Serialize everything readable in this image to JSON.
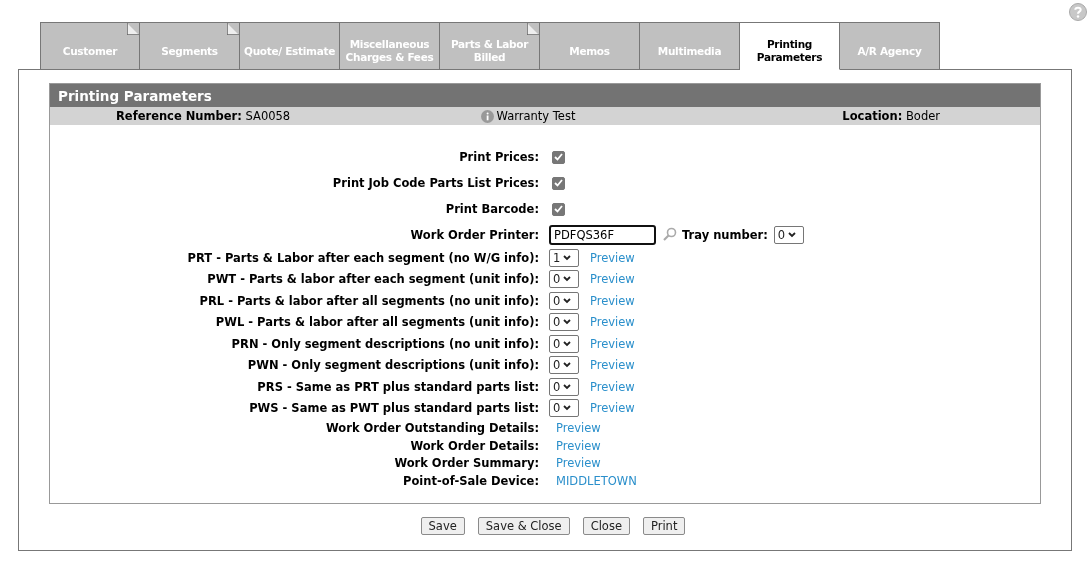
{
  "tabs": [
    {
      "label": "Customer",
      "selected": false,
      "flagged": true
    },
    {
      "label": "Segments",
      "selected": false,
      "flagged": true
    },
    {
      "label": "Quote/ Estimate",
      "selected": false,
      "flagged": false
    },
    {
      "label": "Miscellaneous Charges & Fees",
      "selected": false,
      "flagged": false
    },
    {
      "label": "Parts & Labor Billed",
      "selected": false,
      "flagged": true
    },
    {
      "label": "Memos",
      "selected": false,
      "flagged": false
    },
    {
      "label": "Multimedia",
      "selected": false,
      "flagged": false
    },
    {
      "label": "Printing Parameters",
      "selected": true,
      "flagged": false
    },
    {
      "label": "A/R Agency",
      "selected": false,
      "flagged": false
    }
  ],
  "panel": {
    "title": "Printing Parameters",
    "reference_label": "Reference Number:",
    "reference_value": "SA0058",
    "description": "Warranty Test",
    "location_label": "Location:",
    "location_value": "Boder"
  },
  "rows": [
    {
      "kind": "checkbox",
      "label": "Print Prices:",
      "checked": true
    },
    {
      "kind": "checkbox",
      "label": "Print Job Code Parts List Prices:",
      "checked": true
    },
    {
      "kind": "checkbox",
      "label": "Print Barcode:",
      "checked": true
    },
    {
      "kind": "printer",
      "label": "Work Order Printer:",
      "value": "PDFQS36F",
      "tray_label": "Tray number:",
      "tray_value": "0"
    },
    {
      "kind": "select",
      "label": "PRT - Parts & Labor after each segment (no W/G info):",
      "value": "1",
      "link": "Preview"
    },
    {
      "kind": "select",
      "label": "PWT - Parts & labor after each segment (unit info):",
      "value": "0",
      "link": "Preview"
    },
    {
      "kind": "select",
      "label": "PRL - Parts & labor after all segments (no unit info):",
      "value": "0",
      "link": "Preview"
    },
    {
      "kind": "select",
      "label": "PWL - Parts & labor after all segments (unit info):",
      "value": "0",
      "link": "Preview"
    },
    {
      "kind": "select",
      "label": "PRN - Only segment descriptions (no unit info):",
      "value": "0",
      "link": "Preview"
    },
    {
      "kind": "select",
      "label": "PWN - Only segment descriptions (unit info):",
      "value": "0",
      "link": "Preview"
    },
    {
      "kind": "select",
      "label": "PRS - Same as PRT plus standard parts list:",
      "value": "0",
      "link": "Preview"
    },
    {
      "kind": "select",
      "label": "PWS - Same as PWT plus standard parts list:",
      "value": "0",
      "link": "Preview"
    },
    {
      "kind": "link",
      "label": "Work Order Outstanding Details:",
      "link": "Preview"
    },
    {
      "kind": "link",
      "label": "Work Order Details:",
      "link": "Preview"
    },
    {
      "kind": "link",
      "label": "Work Order Summary:",
      "link": "Preview"
    },
    {
      "kind": "link",
      "label": "Point-of-Sale Device:",
      "link": "MIDDLETOWN"
    }
  ],
  "buttons": [
    "Save",
    "Save & Close",
    "Close",
    "Print"
  ]
}
